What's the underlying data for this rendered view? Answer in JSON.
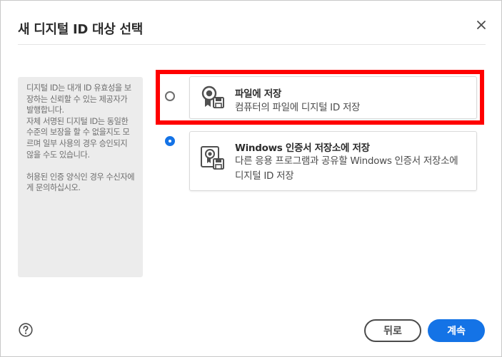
{
  "dialog": {
    "title": "새 디지털 ID 대상 선택",
    "close_icon": "close-icon"
  },
  "info": {
    "paragraph1": "디지털 ID는 대개 ID 유효성을 보장하는 신뢰할 수 있는 제공자가 발행합니다.\n자체 서명된 디지털 ID는 동일한 수준의 보장을 할 수 없을지도 모르며 일부 사용의 경우 승인되지 않을 수도 있습니다.",
    "paragraph2": "허용된 인증 양식인 경우 수신자에게 문의하십시오."
  },
  "options": [
    {
      "title": "파일에 저장",
      "description": "컴퓨터의 파일에 디지털 ID 저장",
      "selected": false,
      "icon": "certificate-file-icon"
    },
    {
      "title": "Windows 인증서 저장소에 저장",
      "description": "다른 응용 프로그램과 공유할 Windows 인증서 저장소에 디지털 ID 저장",
      "selected": true,
      "icon": "certificate-store-icon"
    }
  ],
  "footer": {
    "help_icon": "help-icon",
    "back_label": "뒤로",
    "next_label": "계속"
  },
  "colors": {
    "accent": "#1473e6",
    "highlight": "#ff0000",
    "panel_bg": "#ececec"
  }
}
